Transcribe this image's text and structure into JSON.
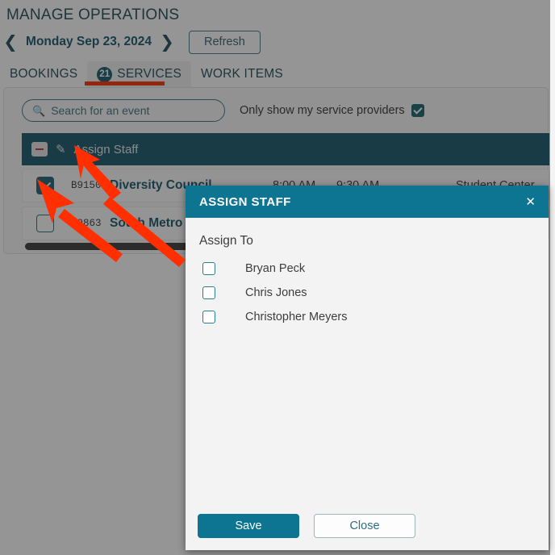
{
  "header": {
    "title": "MANAGE OPERATIONS",
    "prev_icon": "chevron-left-icon",
    "next_icon": "chevron-right-icon",
    "date": "Monday Sep 23, 2024",
    "refresh_label": "Refresh"
  },
  "tabs": [
    {
      "label": "BOOKINGS",
      "badge": "",
      "active": false
    },
    {
      "label": "SERVICES",
      "badge": "21",
      "active": true
    },
    {
      "label": "WORK ITEMS",
      "badge": "",
      "active": false
    }
  ],
  "filters": {
    "search_placeholder": "Search for an event",
    "search_value": "",
    "search_icon": "search-icon",
    "provider_filter_label": "Only show my service providers",
    "provider_filter_checked": true
  },
  "group_row": {
    "collapse_icon": "collapse-minus-icon",
    "edit_icon": "pencil-icon",
    "label": "Assign Staff"
  },
  "table": {
    "rows": [
      {
        "checked": true,
        "id": "B9150",
        "name": "Diversity Council",
        "start": "8:00 AM",
        "end": "9:30 AM",
        "location": "Student Center"
      },
      {
        "checked": false,
        "id": "Q9863",
        "name": "South Metro Me",
        "start": "",
        "end": "",
        "location": ""
      }
    ]
  },
  "modal": {
    "title": "ASSIGN STAFF",
    "close_icon": "close-icon",
    "assign_to_label": "Assign To",
    "staff": [
      {
        "name": "Bryan Peck",
        "checked": false
      },
      {
        "name": "Chris Jones",
        "checked": false
      },
      {
        "name": "Christopher Meyers",
        "checked": false
      }
    ],
    "save_label": "Save",
    "close_label": "Close"
  },
  "colors": {
    "teal_accent": "#0d7491",
    "dark_teal": "#14566b",
    "annotation_red": "#ff2f00",
    "page_dim": "rgba(30,30,30,0.47)"
  }
}
